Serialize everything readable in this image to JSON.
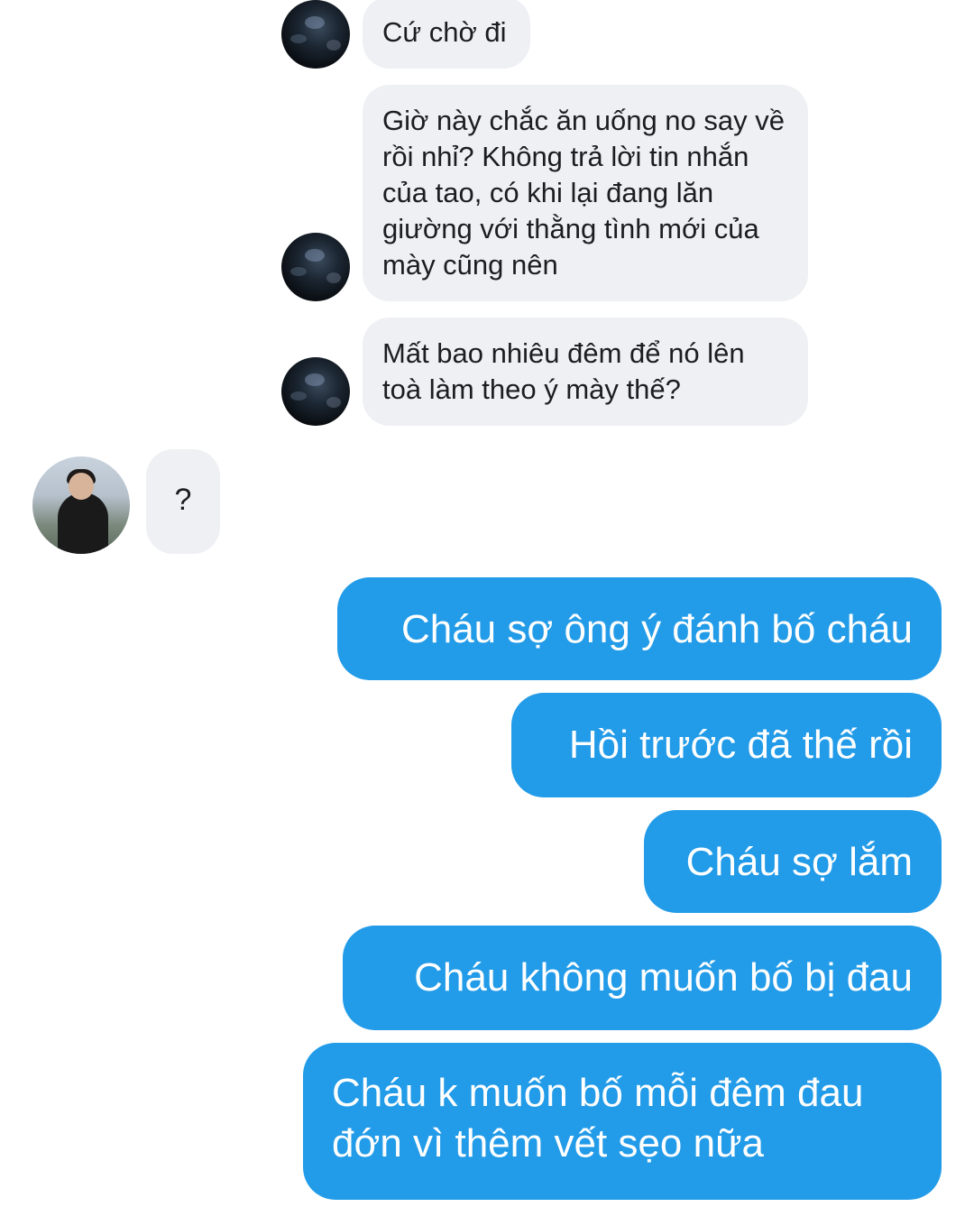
{
  "conversation": {
    "incoming_dark": [
      {
        "text": "Cứ chờ đi"
      },
      {
        "text": "Giờ này chắc ăn uống no say về rồi nhỉ? Không trả lời tin nhắn của tao, có khi lại đang lăn giường với thằng tình mới của mày cũng nên"
      },
      {
        "text": "Mất bao nhiêu đêm để nó lên toà làm theo ý mày thế?"
      }
    ],
    "incoming_photo": {
      "text": "?"
    },
    "outgoing": [
      {
        "text": "Cháu sợ ông ý đánh bố cháu"
      },
      {
        "text": "Hồi trước đã thế rồi"
      },
      {
        "text": "Cháu sợ lắm"
      },
      {
        "text": "Cháu không muốn bố bị đau"
      },
      {
        "text": "Cháu k muốn bố mỗi đêm đau đớn vì thêm vết sẹo nữa"
      }
    ]
  },
  "colors": {
    "outgoing_bubble": "#229be8",
    "incoming_bubble": "#eef0f3",
    "background": "#ffffff"
  }
}
